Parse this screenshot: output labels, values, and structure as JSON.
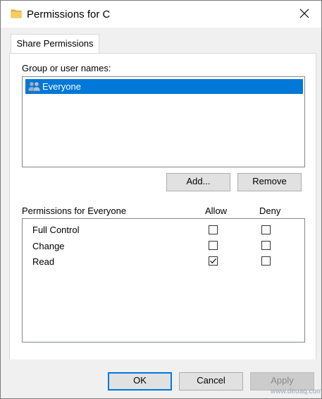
{
  "window": {
    "title": "Permissions for C",
    "close_icon": "close-icon",
    "folder_icon": "folder-icon"
  },
  "tabs": [
    {
      "label": "Share Permissions"
    }
  ],
  "group_section": {
    "label": "Group or user names:",
    "items": [
      {
        "name": "Everyone",
        "selected": true,
        "icon": "users-icon"
      }
    ],
    "add_label": "Add...",
    "remove_label": "Remove"
  },
  "permissions": {
    "label": "Permissions for Everyone",
    "allow_header": "Allow",
    "deny_header": "Deny",
    "rows": [
      {
        "name": "Full Control",
        "allow": false,
        "deny": false
      },
      {
        "name": "Change",
        "allow": false,
        "deny": false
      },
      {
        "name": "Read",
        "allow": true,
        "deny": false
      }
    ]
  },
  "footer": {
    "ok_label": "OK",
    "cancel_label": "Cancel",
    "apply_label": "Apply",
    "apply_disabled": true
  },
  "watermark": "www.deuaq.com"
}
